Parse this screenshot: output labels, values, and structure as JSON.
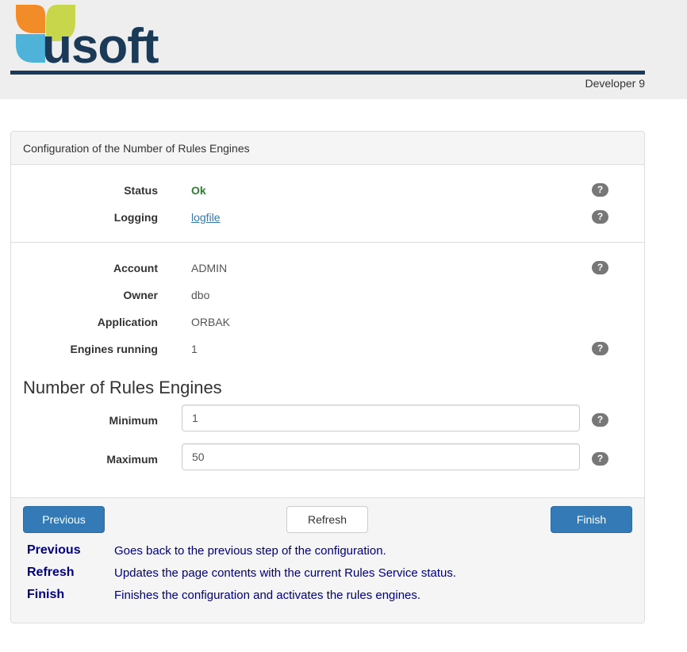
{
  "header": {
    "logo_text": "usoft",
    "version": "Developer 9"
  },
  "panel": {
    "title": "Configuration of the Number of Rules Engines",
    "status": {
      "label": "Status",
      "value": "Ok"
    },
    "logging": {
      "label": "Logging",
      "value": "logfile"
    },
    "account": {
      "label": "Account",
      "value": "ADMIN"
    },
    "owner": {
      "label": "Owner",
      "value": "dbo"
    },
    "application": {
      "label": "Application",
      "value": "ORBAK"
    },
    "engines_running": {
      "label": "Engines running",
      "value": "1"
    },
    "section_title": "Number of Rules Engines",
    "minimum": {
      "label": "Minimum",
      "value": "1"
    },
    "maximum": {
      "label": "Maximum",
      "value": "50"
    },
    "help_glyph": "?"
  },
  "buttons": {
    "previous": "Previous",
    "refresh": "Refresh",
    "finish": "Finish"
  },
  "legend": [
    {
      "key": "Previous",
      "desc": "Goes back to the previous step of the configuration."
    },
    {
      "key": "Refresh",
      "desc": "Updates the page contents with the current Rules Service status."
    },
    {
      "key": "Finish",
      "desc": "Finishes the configuration and activates the rules engines."
    }
  ],
  "colors": {
    "primary": "#337ab7",
    "ok": "#2e7d32",
    "legend_text": "#000080",
    "header_rule": "#1b3a57"
  }
}
